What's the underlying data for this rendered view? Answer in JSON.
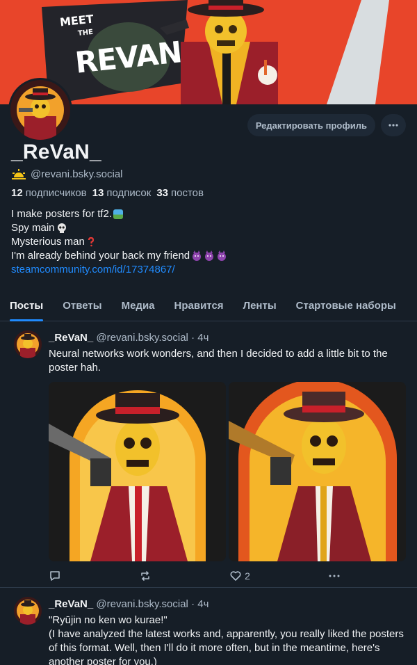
{
  "banner": {
    "meet": "MEET",
    "the": "THE",
    "name": "REVAN"
  },
  "profile": {
    "display_name": "_ReVaN_",
    "handle": "@revani.bsky.social",
    "followers_count": "12",
    "followers_label": "подписчиков",
    "following_count": "13",
    "following_label": "подписок",
    "posts_count": "33",
    "posts_label": "постов",
    "edit_button": "Редактировать профиль",
    "more_button": "···"
  },
  "bio": {
    "line1": "I make posters for tf2.",
    "line2": "Spy main",
    "line3": "Mysterious man",
    "line4": "I'm already behind your back my friend",
    "link": "steamcommunity.com/id/17374867/"
  },
  "tabs": [
    "Посты",
    "Ответы",
    "Медиа",
    "Нравится",
    "Ленты",
    "Стартовые наборы"
  ],
  "posts": [
    {
      "author": "_ReVaN_",
      "handle": "@revani.bsky.social",
      "time": "· 4ч",
      "text": "Neural networks work wonders, and then I decided to add a little bit to the poster hah.",
      "likes": "2"
    },
    {
      "author": "_ReVaN_",
      "handle": "@revani.bsky.social",
      "time": "· 4ч",
      "text1": "\"Ryūjin no ken wo kurae!\"",
      "text2": "(I have analyzed the latest works and, apparently, you really liked the posters of this format. Well, then I'll do it more often, but in the meantime, here's another poster for you.)"
    }
  ],
  "colors": {
    "accent": "#208bfe",
    "background": "#161e27",
    "muted": "#aebbc9",
    "border": "#2e3c4b"
  }
}
